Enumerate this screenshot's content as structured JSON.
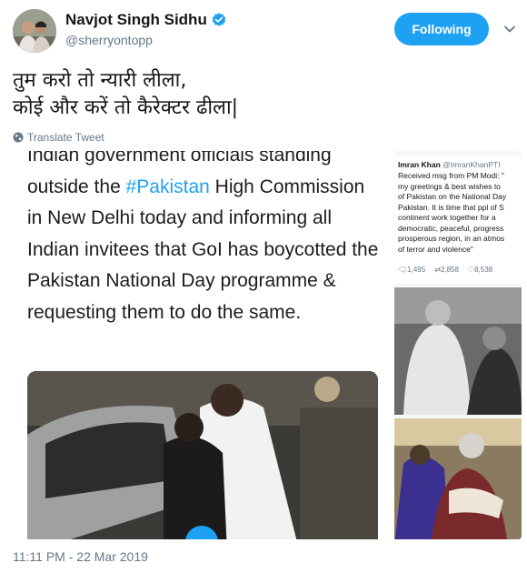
{
  "header": {
    "display_name": "Navjot Singh Sidhu",
    "handle": "@sherryontopp",
    "follow_label": "Following",
    "avatar_icon": "user-avatar",
    "verified_icon": "verified-badge-icon",
    "caret_icon": "chevron-down-icon",
    "accent_color": "#1da1f2"
  },
  "tweet": {
    "line1": "तुम करो तो न्यारी लीला,",
    "line2": "कोई और करें तो कैरेक्टर ढीला|",
    "translate_label": "Translate Tweet",
    "timestamp": "11:11 PM - 22 Mar 2019"
  },
  "media": {
    "embedded_text_part1": "Indian government officials standing outside the ",
    "embedded_hashtag": "#Pakistan",
    "embedded_text_part2": " High Commission in New Delhi today and informing all Indian invitees that GoI has boycotted the Pakistan National Day programme & requesting them to do the same.",
    "quote": {
      "name": "Imran Khan",
      "handle": "@ImranKhanPTI",
      "text": "Received msg from PM Modi: \"\nmy greetings & best wishes to\nof Pakistan on the National Day\nPakistan. It is time that ppl of S\ncontinent work together for a\ndemocratic, peaceful, progress\nprosperous region, in an atmos\nof terror and violence\"",
      "replies": "1,495",
      "retweets": "2,858",
      "likes": "8,538"
    }
  }
}
